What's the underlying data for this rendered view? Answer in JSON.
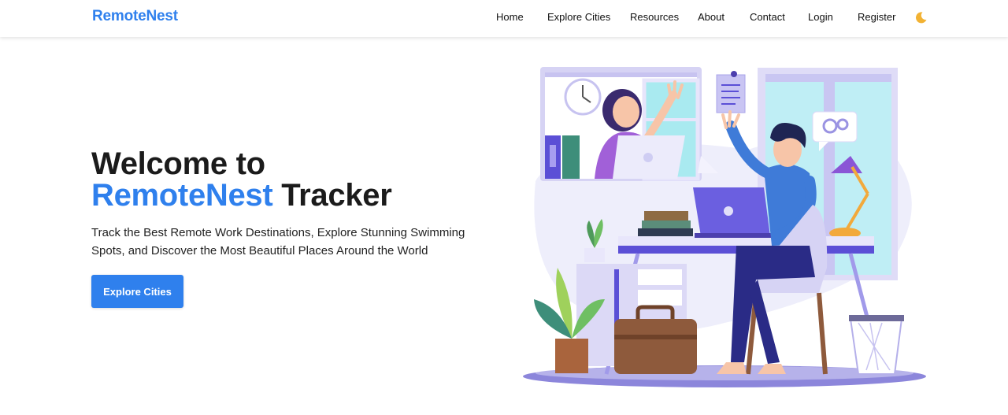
{
  "nav": {
    "brand": "RemoteNest",
    "links": [
      "Home",
      "Explore Cities",
      "Resources",
      "About",
      "Contact",
      "Login",
      "Register"
    ],
    "theme_icon": "moon-icon"
  },
  "hero": {
    "title_line1": "Welcome to",
    "title_accent": "RemoteNest",
    "title_rest": "Tracker",
    "subtitle": "Track the Best Remote Work Destinations, Explore Stunning Swimming Spots, and Discover the Most Beautiful Places Around the World",
    "cta_label": "Explore Cities"
  },
  "colors": {
    "accent": "#2f80ed",
    "text": "#1b1b1b",
    "illustration_purple": "#5b4fd6"
  }
}
